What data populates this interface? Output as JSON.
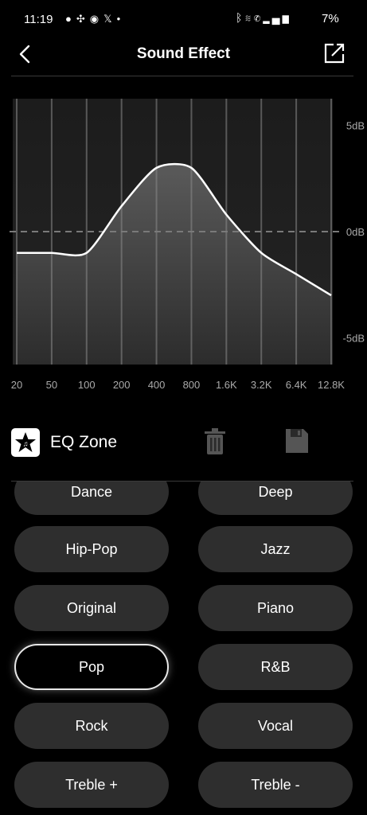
{
  "status_bar": {
    "time": "11:19",
    "left_icons": [
      "chat-icon",
      "network-icon",
      "messenger-icon",
      "x-icon",
      "dot-icon"
    ],
    "right_icons": [
      "bluetooth-icon",
      "wifi-icon",
      "call-icon",
      "signal-icon"
    ],
    "battery": "7%"
  },
  "header": {
    "title": "Sound Effect"
  },
  "eq_graph": {
    "y_labels": [
      "5dB",
      "0dB",
      "-5dB"
    ],
    "x_labels": [
      "20",
      "50",
      "100",
      "200",
      "400",
      "800",
      "1.6K",
      "3.2K",
      "6.4K",
      "12.8K"
    ],
    "band_gains_db": [
      -1,
      -1,
      -1,
      1.2,
      3,
      3,
      0.8,
      -1,
      -2,
      -3
    ],
    "y_range": [
      -5,
      5
    ],
    "reference_line_db": 0
  },
  "eq_zone": {
    "label": "EQ Zone"
  },
  "presets": [
    {
      "label": "Dance",
      "selected": false
    },
    {
      "label": "Deep",
      "selected": false
    },
    {
      "label": "Hip-Pop",
      "selected": false
    },
    {
      "label": "Jazz",
      "selected": false
    },
    {
      "label": "Original",
      "selected": false
    },
    {
      "label": "Piano",
      "selected": false
    },
    {
      "label": "Pop",
      "selected": true
    },
    {
      "label": "R&B",
      "selected": false
    },
    {
      "label": "Rock",
      "selected": false
    },
    {
      "label": "Vocal",
      "selected": false
    },
    {
      "label": "Treble +",
      "selected": false
    },
    {
      "label": "Treble -",
      "selected": false
    }
  ],
  "colors": {
    "background": "#000000",
    "button": "#2e2e2e",
    "curve": "#ffffff"
  }
}
